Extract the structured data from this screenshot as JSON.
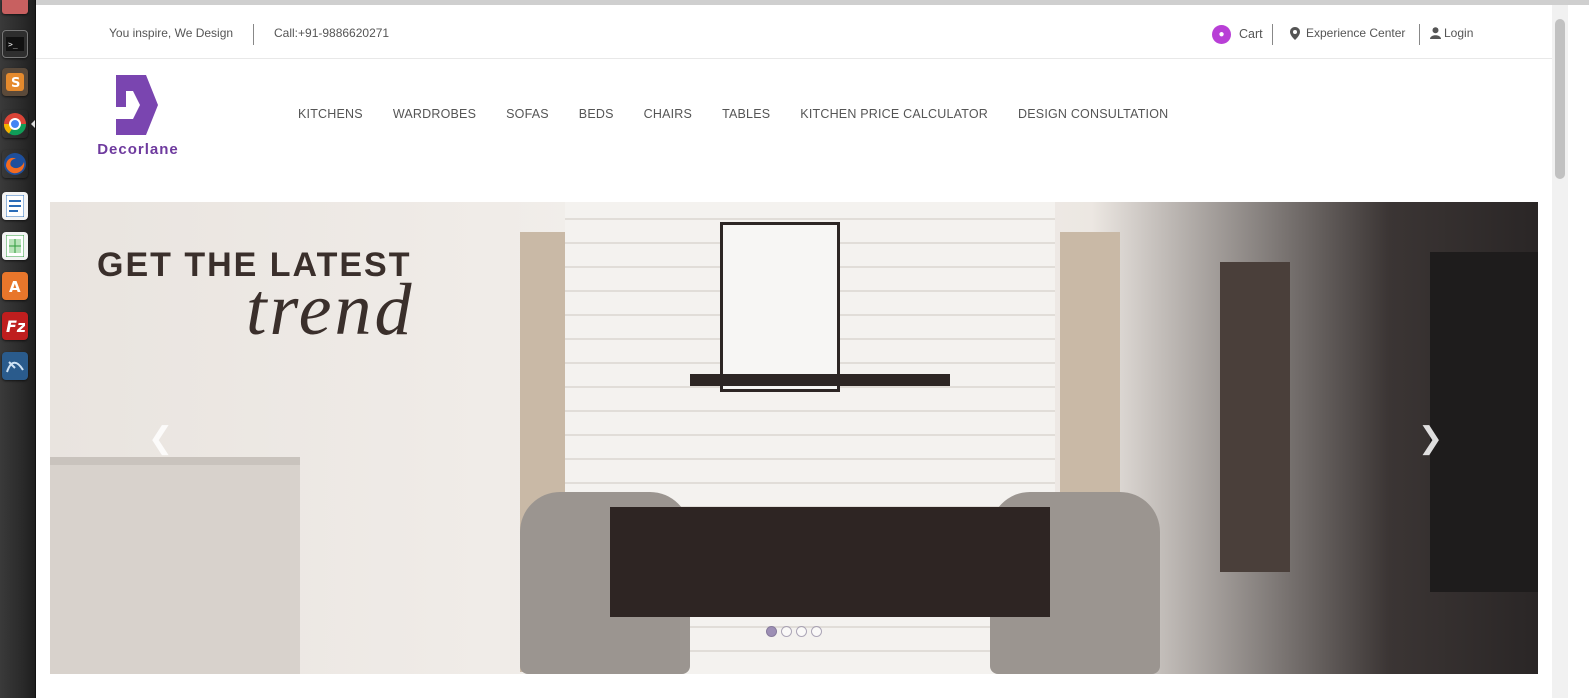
{
  "topbar": {
    "tagline": "You inspire, We Design",
    "call": "Call:+91-9886620271",
    "cart": "Cart",
    "experience": "Experience Center",
    "login": "Login"
  },
  "logo": {
    "text": "Decorlane"
  },
  "nav": {
    "items": [
      "KITCHENS",
      "WARDROBES",
      "SOFAS",
      "BEDS",
      "CHAIRS",
      "TABLES",
      "KITCHEN PRICE CALCULATOR",
      "DESIGN CONSULTATION"
    ]
  },
  "hero": {
    "headline": "GET THE LATEST",
    "headline_accent": "trend",
    "slides": 4,
    "active_slide": 1
  },
  "colors": {
    "brand": "#6e3a9e",
    "cart_badge": "#b83fd6",
    "nav_text": "#555555"
  },
  "launcher": {
    "icons": [
      "terminal-icon",
      "sublime-icon",
      "chrome-icon",
      "firefox-icon",
      "writer-icon",
      "calc-icon",
      "software-center-icon",
      "filezilla-icon",
      "mysql-workbench-icon"
    ]
  }
}
